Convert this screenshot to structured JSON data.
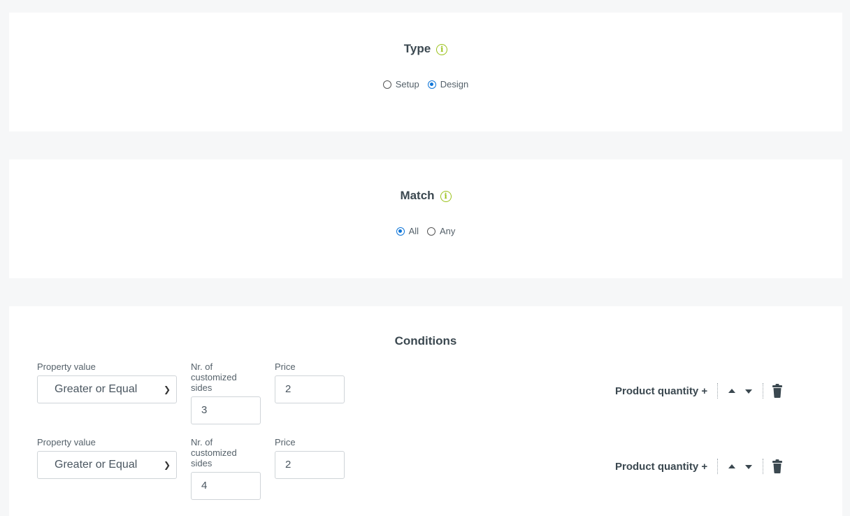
{
  "type_section": {
    "title": "Type",
    "info_icon": "info-icon",
    "options": [
      "Setup",
      "Design"
    ],
    "selected": "Design"
  },
  "match_section": {
    "title": "Match",
    "info_icon": "info-icon",
    "options": [
      "All",
      "Any"
    ],
    "selected": "All"
  },
  "conditions_section": {
    "title": "Conditions",
    "rows": [
      {
        "property_label": "Property value",
        "property_value": "Greater or Equal",
        "sides_label": "Nr. of customized sides",
        "sides_value": "3",
        "price_label": "Price",
        "price_value": "2",
        "add_button": "Product quantity +"
      },
      {
        "property_label": "Property value",
        "property_value": "Greater or Equal",
        "sides_label": "Nr. of customized sides",
        "sides_value": "4",
        "price_label": "Price",
        "price_value": "2",
        "add_button": "Product quantity +"
      }
    ]
  },
  "colors": {
    "accent_radio": "#0f75d8",
    "info_icon": "#9bc21a",
    "background": "#f6f7f8"
  }
}
